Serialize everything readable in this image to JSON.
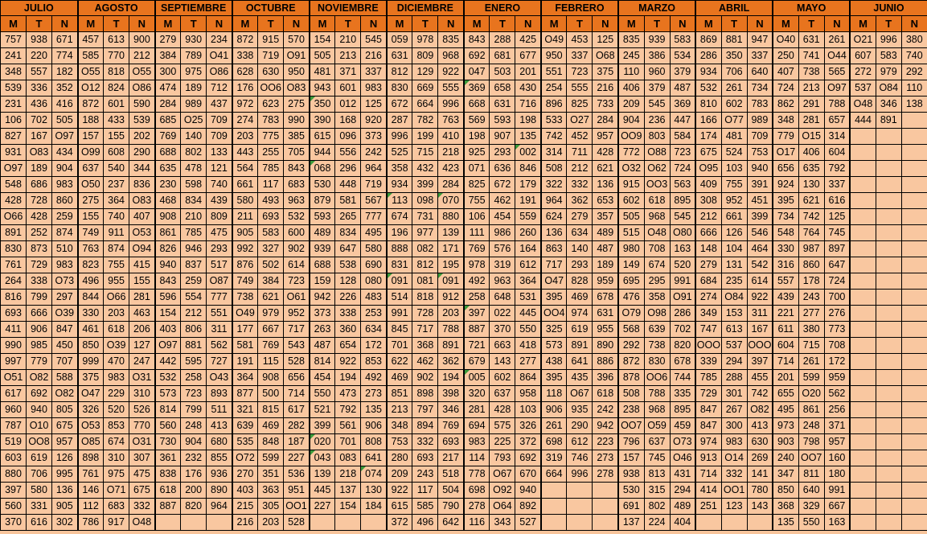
{
  "months": [
    "JULIO",
    "AGOSTO",
    "SEPTIEMBRE",
    "OCTUBRE",
    "NOVIEMBRE",
    "DICIEMBRE",
    "ENERO",
    "FEBRERO",
    "MARZO",
    "ABRIL",
    "MAYO",
    "JUNIO"
  ],
  "shifts": [
    "M",
    "T",
    "N"
  ],
  "rows": [
    [
      "757",
      "938",
      "671",
      "457",
      "613",
      "900",
      "279",
      "930",
      "234",
      "872",
      "915",
      "570",
      "154",
      "210",
      "545",
      "059",
      "978",
      "835",
      "843",
      "288",
      "425",
      "O49",
      "453",
      "125",
      "835",
      "939",
      "583",
      "869",
      "881",
      "947",
      "O40",
      "631",
      "261",
      "O21",
      "996",
      "380"
    ],
    [
      "241",
      "220",
      "774",
      "585",
      "770",
      "212",
      "384",
      "789",
      "O41",
      "338",
      "719",
      "O91",
      "505",
      "213",
      "216",
      "631",
      "809",
      "968",
      "692",
      "681",
      "677",
      "950",
      "337",
      "O68",
      "245",
      "386",
      "534",
      "286",
      "350",
      "337",
      "250",
      "741",
      "O44",
      "607",
      "583",
      "740"
    ],
    [
      "348",
      "557",
      "182",
      "O55",
      "818",
      "O55",
      "300",
      "975",
      "O86",
      "628",
      "630",
      "950",
      "481",
      "371",
      "337",
      "812",
      "129",
      "922",
      "047",
      "503",
      "201",
      "551",
      "723",
      "375",
      "110",
      "960",
      "379",
      "934",
      "706",
      "640",
      "407",
      "738",
      "565",
      "272",
      "979",
      "292"
    ],
    [
      "539",
      "336",
      "352",
      "O12",
      "824",
      "O86",
      "474",
      "189",
      "712",
      "176",
      "OO6",
      "O83",
      "943",
      "601",
      "983",
      "830",
      "669",
      "555",
      "369",
      "658",
      "430",
      "254",
      "555",
      "216",
      "406",
      "379",
      "487",
      "532",
      "261",
      "734",
      "724",
      "213",
      "O97",
      "537",
      "O84",
      "110"
    ],
    [
      "231",
      "436",
      "416",
      "872",
      "601",
      "590",
      "284",
      "989",
      "437",
      "972",
      "623",
      "275",
      "350",
      "012",
      "125",
      "672",
      "664",
      "996",
      "668",
      "631",
      "716",
      "896",
      "825",
      "733",
      "209",
      "545",
      "369",
      "810",
      "602",
      "783",
      "862",
      "291",
      "788",
      "O48",
      "346",
      "138"
    ],
    [
      "106",
      "702",
      "505",
      "188",
      "433",
      "539",
      "685",
      "O25",
      "709",
      "274",
      "783",
      "990",
      "390",
      "168",
      "920",
      "287",
      "782",
      "763",
      "569",
      "593",
      "198",
      "533",
      "O27",
      "284",
      "904",
      "236",
      "447",
      "166",
      "O77",
      "989",
      "348",
      "281",
      "657",
      "444",
      "891",
      ""
    ],
    [
      "827",
      "167",
      "O97",
      "157",
      "155",
      "202",
      "769",
      "140",
      "709",
      "203",
      "775",
      "385",
      "615",
      "096",
      "373",
      "996",
      "199",
      "410",
      "198",
      "907",
      "135",
      "742",
      "452",
      "957",
      "OO9",
      "803",
      "584",
      "174",
      "481",
      "709",
      "779",
      "O15",
      "314",
      "",
      "",
      ""
    ],
    [
      "931",
      "O83",
      "434",
      "O99",
      "608",
      "290",
      "688",
      "802",
      "133",
      "443",
      "255",
      "705",
      "944",
      "556",
      "242",
      "525",
      "715",
      "218",
      "925",
      "293",
      "002",
      "314",
      "711",
      "428",
      "772",
      "O88",
      "723",
      "675",
      "524",
      "753",
      "O17",
      "406",
      "604",
      "",
      "",
      ""
    ],
    [
      "O97",
      "189",
      "904",
      "637",
      "540",
      "344",
      "635",
      "478",
      "121",
      "564",
      "785",
      "843",
      "068",
      "296",
      "964",
      "358",
      "432",
      "423",
      "071",
      "636",
      "846",
      "508",
      "212",
      "621",
      "O32",
      "O62",
      "724",
      "O95",
      "103",
      "940",
      "656",
      "635",
      "792",
      "",
      "",
      ""
    ],
    [
      "548",
      "686",
      "983",
      "O50",
      "237",
      "836",
      "230",
      "598",
      "740",
      "661",
      "117",
      "683",
      "530",
      "448",
      "719",
      "934",
      "399",
      "284",
      "825",
      "672",
      "179",
      "322",
      "332",
      "136",
      "915",
      "OO3",
      "563",
      "409",
      "755",
      "391",
      "924",
      "130",
      "337",
      "",
      "",
      ""
    ],
    [
      "428",
      "728",
      "860",
      "275",
      "364",
      "O83",
      "468",
      "834",
      "439",
      "580",
      "493",
      "963",
      "879",
      "581",
      "567",
      "113",
      "098",
      "070",
      "755",
      "462",
      "191",
      "964",
      "362",
      "653",
      "602",
      "618",
      "895",
      "308",
      "952",
      "451",
      "395",
      "621",
      "616",
      "",
      "",
      ""
    ],
    [
      "O66",
      "428",
      "259",
      "155",
      "740",
      "407",
      "908",
      "210",
      "809",
      "211",
      "693",
      "532",
      "593",
      "265",
      "777",
      "674",
      "731",
      "880",
      "106",
      "454",
      "559",
      "624",
      "279",
      "357",
      "505",
      "968",
      "545",
      "212",
      "661",
      "399",
      "734",
      "742",
      "125",
      "",
      "",
      ""
    ],
    [
      "891",
      "252",
      "874",
      "749",
      "911",
      "O53",
      "861",
      "785",
      "475",
      "905",
      "583",
      "600",
      "489",
      "834",
      "495",
      "196",
      "977",
      "139",
      "111",
      "986",
      "260",
      "136",
      "634",
      "489",
      "515",
      "O48",
      "O80",
      "666",
      "126",
      "546",
      "548",
      "764",
      "745",
      "",
      "",
      ""
    ],
    [
      "830",
      "873",
      "510",
      "763",
      "874",
      "O94",
      "826",
      "946",
      "293",
      "992",
      "327",
      "902",
      "939",
      "647",
      "580",
      "888",
      "082",
      "171",
      "769",
      "576",
      "164",
      "863",
      "140",
      "487",
      "980",
      "708",
      "163",
      "148",
      "104",
      "464",
      "330",
      "987",
      "897",
      "",
      "",
      ""
    ],
    [
      "761",
      "729",
      "983",
      "823",
      "755",
      "415",
      "940",
      "837",
      "517",
      "876",
      "502",
      "614",
      "688",
      "538",
      "690",
      "831",
      "812",
      "195",
      "978",
      "319",
      "612",
      "717",
      "293",
      "189",
      "149",
      "674",
      "520",
      "279",
      "131",
      "542",
      "316",
      "860",
      "647",
      "",
      "",
      ""
    ],
    [
      "264",
      "338",
      "O73",
      "496",
      "955",
      "155",
      "843",
      "259",
      "O87",
      "749",
      "384",
      "723",
      "159",
      "128",
      "080",
      "091",
      "081",
      "091",
      "492",
      "963",
      "364",
      "O47",
      "828",
      "959",
      "695",
      "295",
      "991",
      "684",
      "235",
      "614",
      "557",
      "178",
      "724",
      "",
      "",
      ""
    ],
    [
      "816",
      "799",
      "297",
      "844",
      "O66",
      "281",
      "596",
      "554",
      "777",
      "738",
      "621",
      "O61",
      "942",
      "226",
      "483",
      "514",
      "818",
      "912",
      "258",
      "648",
      "531",
      "395",
      "469",
      "678",
      "476",
      "358",
      "O91",
      "274",
      "O84",
      "922",
      "439",
      "243",
      "700",
      "",
      "",
      ""
    ],
    [
      "693",
      "666",
      "O39",
      "330",
      "203",
      "463",
      "154",
      "212",
      "551",
      "O49",
      "979",
      "952",
      "373",
      "338",
      "253",
      "991",
      "728",
      "203",
      "397",
      "022",
      "445",
      "OO4",
      "974",
      "631",
      "O79",
      "O98",
      "286",
      "349",
      "153",
      "311",
      "221",
      "277",
      "276",
      "",
      "",
      ""
    ],
    [
      "411",
      "906",
      "847",
      "461",
      "618",
      "206",
      "403",
      "806",
      "311",
      "177",
      "667",
      "717",
      "263",
      "360",
      "634",
      "845",
      "717",
      "788",
      "887",
      "370",
      "550",
      "325",
      "619",
      "955",
      "568",
      "639",
      "702",
      "747",
      "613",
      "167",
      "611",
      "380",
      "773",
      "",
      "",
      ""
    ],
    [
      "990",
      "985",
      "450",
      "850",
      "O39",
      "127",
      "O97",
      "881",
      "562",
      "581",
      "769",
      "543",
      "487",
      "654",
      "172",
      "701",
      "368",
      "891",
      "721",
      "663",
      "418",
      "573",
      "891",
      "890",
      "292",
      "738",
      "820",
      "OOO",
      "537",
      "OOO",
      "604",
      "715",
      "708",
      "",
      "",
      ""
    ],
    [
      "997",
      "779",
      "707",
      "999",
      "470",
      "247",
      "442",
      "595",
      "727",
      "191",
      "115",
      "528",
      "814",
      "922",
      "853",
      "622",
      "462",
      "362",
      "679",
      "143",
      "277",
      "438",
      "641",
      "886",
      "872",
      "830",
      "678",
      "339",
      "294",
      "397",
      "714",
      "261",
      "172",
      "",
      "",
      ""
    ],
    [
      "O51",
      "O82",
      "588",
      "375",
      "983",
      "O31",
      "532",
      "258",
      "O43",
      "364",
      "908",
      "656",
      "454",
      "194",
      "492",
      "469",
      "902",
      "194",
      "005",
      "602",
      "864",
      "395",
      "435",
      "396",
      "878",
      "OO6",
      "744",
      "785",
      "288",
      "455",
      "201",
      "599",
      "959",
      "",
      "",
      ""
    ],
    [
      "617",
      "692",
      "O82",
      "O47",
      "229",
      "310",
      "573",
      "723",
      "893",
      "877",
      "500",
      "714",
      "550",
      "473",
      "273",
      "851",
      "898",
      "398",
      "320",
      "637",
      "958",
      "118",
      "O67",
      "618",
      "508",
      "788",
      "335",
      "729",
      "301",
      "742",
      "655",
      "O20",
      "562",
      "",
      "",
      ""
    ],
    [
      "960",
      "940",
      "805",
      "326",
      "520",
      "526",
      "814",
      "799",
      "511",
      "321",
      "815",
      "617",
      "521",
      "792",
      "135",
      "213",
      "797",
      "346",
      "281",
      "428",
      "103",
      "906",
      "935",
      "242",
      "238",
      "968",
      "895",
      "847",
      "267",
      "O82",
      "495",
      "861",
      "256",
      "",
      "",
      ""
    ],
    [
      "787",
      "O10",
      "675",
      "O53",
      "853",
      "770",
      "560",
      "248",
      "413",
      "639",
      "469",
      "282",
      "399",
      "561",
      "906",
      "348",
      "894",
      "769",
      "694",
      "575",
      "326",
      "261",
      "290",
      "942",
      "OO7",
      "O59",
      "459",
      "847",
      "300",
      "413",
      "973",
      "248",
      "371",
      "",
      "",
      ""
    ],
    [
      "519",
      "OO8",
      "957",
      "O85",
      "674",
      "O31",
      "730",
      "904",
      "680",
      "535",
      "848",
      "187",
      "020",
      "701",
      "808",
      "753",
      "332",
      "693",
      "983",
      "225",
      "372",
      "698",
      "612",
      "223",
      "796",
      "637",
      "O73",
      "974",
      "983",
      "630",
      "903",
      "798",
      "957",
      "",
      "",
      ""
    ],
    [
      "603",
      "619",
      "126",
      "898",
      "310",
      "307",
      "361",
      "232",
      "855",
      "O72",
      "599",
      "227",
      "043",
      "083",
      "641",
      "280",
      "693",
      "217",
      "114",
      "793",
      "692",
      "319",
      "746",
      "273",
      "157",
      "745",
      "O46",
      "913",
      "O14",
      "269",
      "240",
      "OO7",
      "160",
      "",
      "",
      ""
    ],
    [
      "880",
      "706",
      "995",
      "761",
      "975",
      "475",
      "838",
      "176",
      "936",
      "270",
      "351",
      "536",
      "139",
      "218",
      "074",
      "209",
      "243",
      "518",
      "778",
      "O67",
      "670",
      "664",
      "996",
      "278",
      "938",
      "813",
      "431",
      "714",
      "332",
      "141",
      "347",
      "811",
      "180",
      "",
      "",
      ""
    ],
    [
      "397",
      "580",
      "136",
      "146",
      "O71",
      "675",
      "618",
      "200",
      "890",
      "403",
      "363",
      "951",
      "445",
      "137",
      "130",
      "922",
      "117",
      "504",
      "698",
      "O92",
      "940",
      "",
      "",
      "",
      "530",
      "315",
      "294",
      "414",
      "OO1",
      "780",
      "850",
      "640",
      "991",
      "",
      "",
      ""
    ],
    [
      "560",
      "331",
      "905",
      "112",
      "683",
      "332",
      "887",
      "820",
      "964",
      "215",
      "305",
      "OO1",
      "227",
      "154",
      "184",
      "615",
      "585",
      "790",
      "278",
      "O64",
      "892",
      "",
      "",
      "",
      "691",
      "802",
      "489",
      "251",
      "123",
      "143",
      "368",
      "329",
      "667",
      "",
      "",
      ""
    ],
    [
      "370",
      "616",
      "302",
      "786",
      "917",
      "O48",
      "",
      "",
      "",
      "216",
      "203",
      "528",
      "",
      "",
      "",
      "372",
      "496",
      "642",
      "116",
      "343",
      "527",
      "",
      "",
      "",
      "137",
      "224",
      "404",
      "",
      "",
      "",
      "135",
      "550",
      "163",
      "",
      "",
      ""
    ]
  ],
  "marked_cells": [
    [
      3,
      18
    ],
    [
      4,
      12
    ],
    [
      7,
      20
    ],
    [
      8,
      12
    ],
    [
      10,
      15
    ],
    [
      10,
      17
    ],
    [
      15,
      15
    ],
    [
      15,
      17
    ],
    [
      17,
      18
    ],
    [
      21,
      18
    ],
    [
      25,
      12
    ],
    [
      26,
      12
    ],
    [
      27,
      14
    ]
  ]
}
